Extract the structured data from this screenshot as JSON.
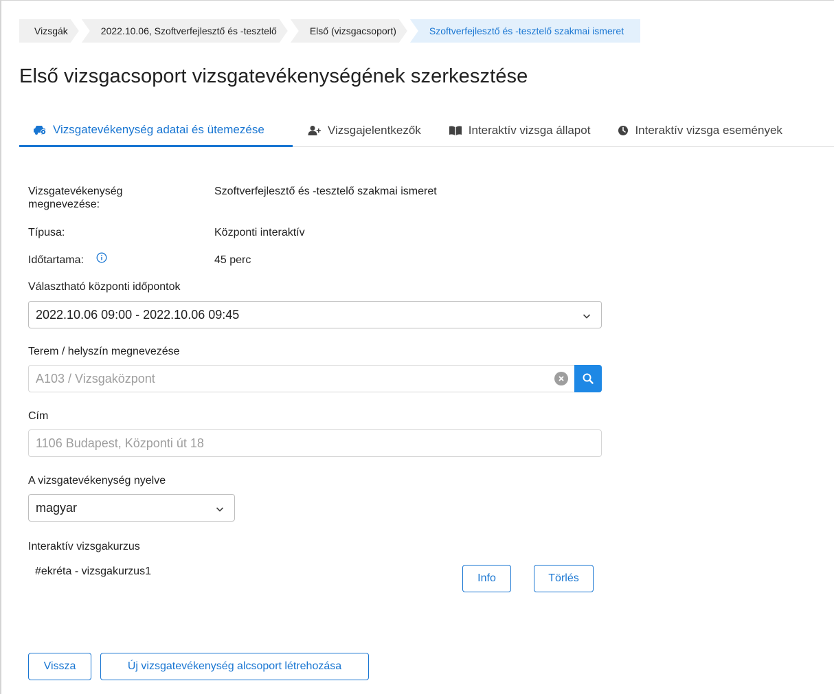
{
  "breadcrumb": [
    {
      "label": "Vizsgák"
    },
    {
      "label": "2022.10.06, Szoftverfejlesztő és -tesztelő"
    },
    {
      "label": "Első (vizsgacsoport)"
    },
    {
      "label": "Szoftverfejlesztő és -tesztelő szakmai ismeret"
    }
  ],
  "page_title": "Első vizsgacsoport vizsgatevékenységének szerkesztése",
  "tabs": [
    {
      "label": "Vizsgatevékenység adatai és ütemezése",
      "icon": "car-icon",
      "active": true
    },
    {
      "label": "Vizsgajelentkezők",
      "icon": "add-user-icon",
      "active": false
    },
    {
      "label": "Interaktív vizsga állapot",
      "icon": "book-icon",
      "active": false
    },
    {
      "label": "Interaktív vizsga események",
      "icon": "clock-icon",
      "active": false
    }
  ],
  "details": {
    "name_label_line1": "Vizsgatevékenység",
    "name_label_line2": "megnevezése:",
    "name_value": "Szoftverfejlesztő és -tesztelő szakmai ismeret",
    "type_label": "Típusa:",
    "type_value": "Központi interaktív",
    "duration_label": "Időtartama:",
    "duration_value": "45 perc"
  },
  "form": {
    "timeslot_label": "Választható központi időpontok",
    "timeslot_value": "2022.10.06 09:00 - 2022.10.06 09:45",
    "room_label": "Terem / helyszín megnevezése",
    "room_value": "A103 / Vizsgaközpont",
    "address_label": "Cím",
    "address_value": "1106 Budapest, Központi út 18",
    "language_label": "A vizsgatevékenység nyelve",
    "language_value": "magyar",
    "course_label": "Interaktív vizsgakurzus",
    "course_value": "#ekréta - vizsgakurzus1",
    "info_button": "Info",
    "delete_button": "Törlés"
  },
  "footer": {
    "back_button": "Vissza",
    "new_subgroup_button": "Új vizsgatevékenység alcsoport létrehozása"
  },
  "colors": {
    "accent": "#1976d2",
    "breadcrumb_bg": "#f0f0f0",
    "breadcrumb_active_bg": "#e3f0fc",
    "search_button": "#1e88e5"
  }
}
